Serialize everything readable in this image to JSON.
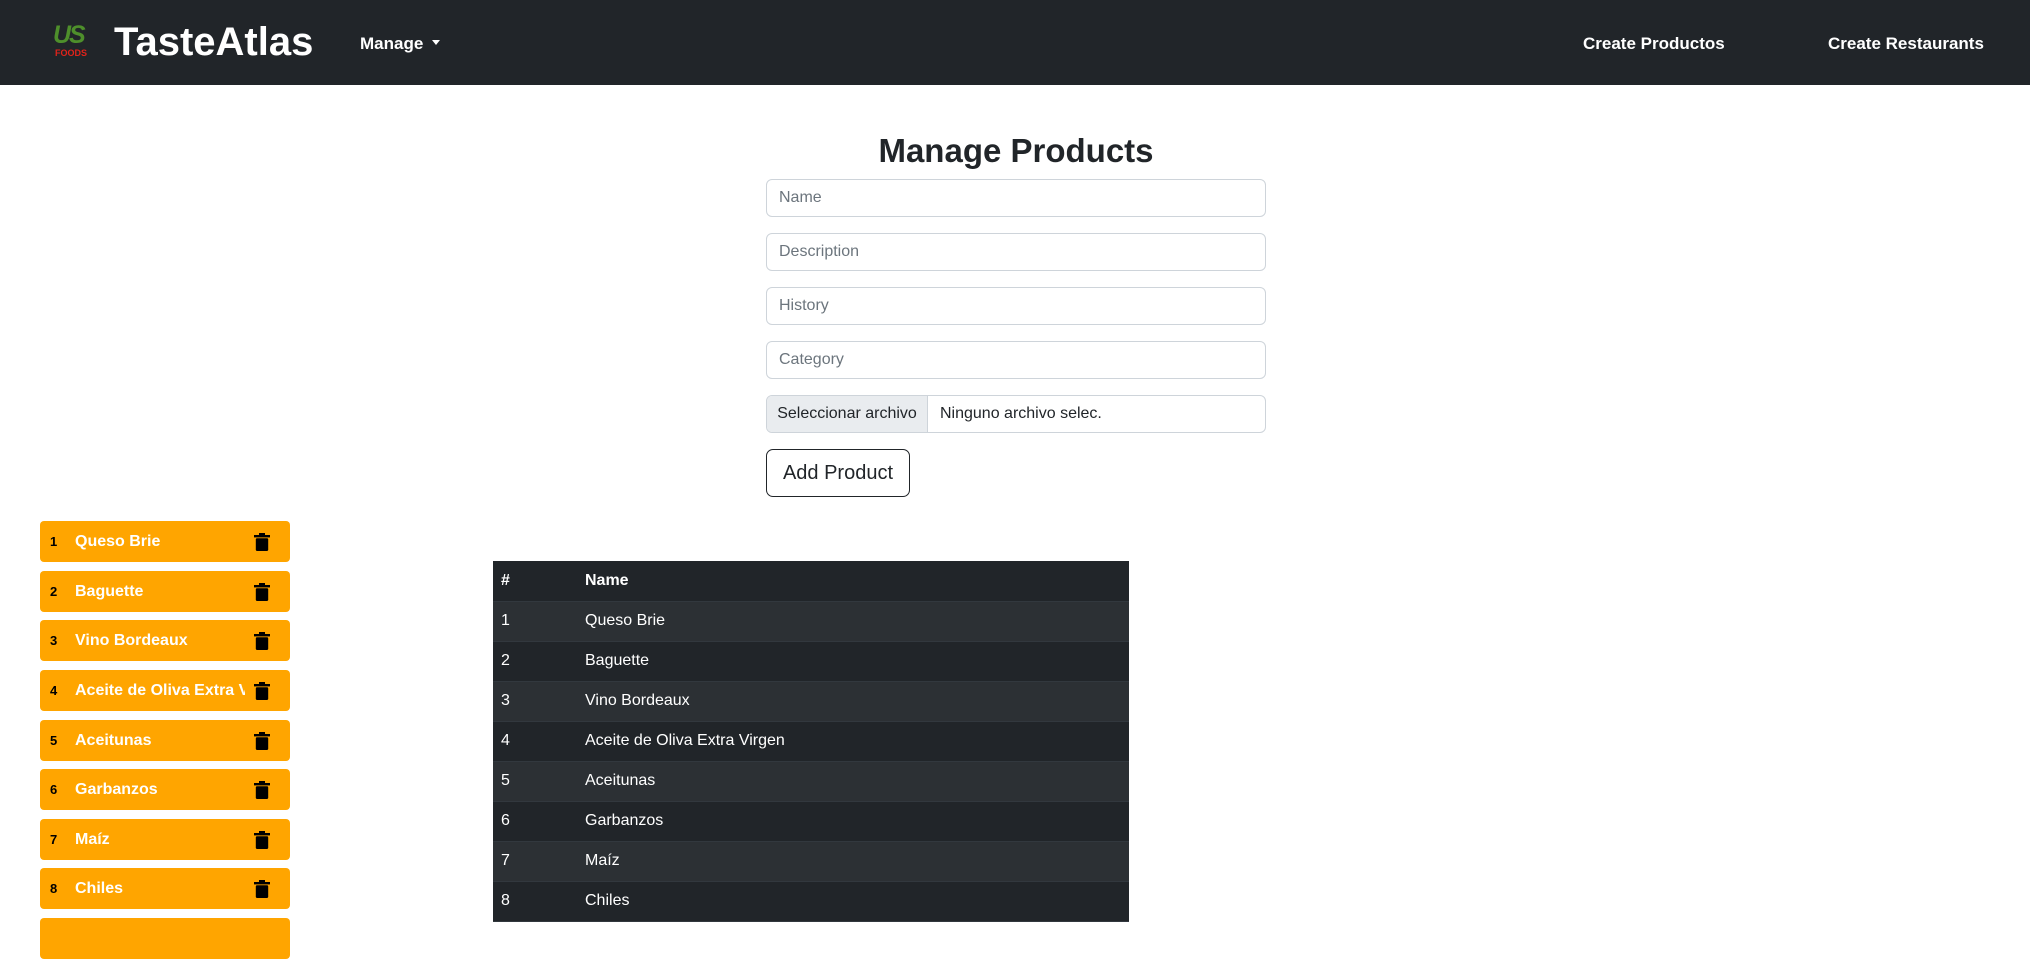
{
  "navbar": {
    "logo_us": "US",
    "logo_foods": "FOODS",
    "brand": "TasteAtlas",
    "manage_label": "Manage",
    "create_productos": "Create Productos",
    "create_restaurants": "Create Restaurants"
  },
  "form": {
    "title": "Manage Products",
    "name_placeholder": "Name",
    "description_placeholder": "Description",
    "history_placeholder": "History",
    "category_placeholder": "Category",
    "file_button": "Seleccionar archivo",
    "file_status": "Ninguno archivo selec.",
    "add_button": "Add Product"
  },
  "side_list": {
    "items": [
      {
        "num": "1",
        "label": "Queso Brie"
      },
      {
        "num": "2",
        "label": "Baguette"
      },
      {
        "num": "3",
        "label": "Vino Bordeaux"
      },
      {
        "num": "4",
        "label": "Aceite de Oliva Extra Virgen"
      },
      {
        "num": "5",
        "label": "Aceitunas"
      },
      {
        "num": "6",
        "label": "Garbanzos"
      },
      {
        "num": "7",
        "label": "Maíz"
      },
      {
        "num": "8",
        "label": "Chiles"
      }
    ],
    "color": "#ffa500",
    "icon": "trash-icon"
  },
  "table": {
    "headers": [
      "#",
      "Name"
    ],
    "rows": [
      [
        "1",
        "Queso Brie"
      ],
      [
        "2",
        "Baguette"
      ],
      [
        "3",
        "Vino Bordeaux"
      ],
      [
        "4",
        "Aceite de Oliva Extra Virgen"
      ],
      [
        "5",
        "Aceitunas"
      ],
      [
        "6",
        "Garbanzos"
      ],
      [
        "7",
        "Maíz"
      ],
      [
        "8",
        "Chiles"
      ]
    ]
  },
  "colors": {
    "navbar_bg": "#212529",
    "accent": "#ffa500",
    "table_bg": "#212529"
  }
}
